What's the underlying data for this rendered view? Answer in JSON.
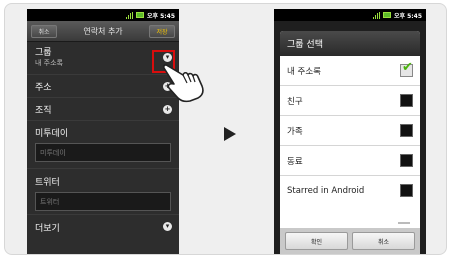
{
  "left": {
    "status": {
      "time": "오후 5:45"
    },
    "toolbar": {
      "cancel": "취소",
      "title": "연락처 추가",
      "save": "저장"
    },
    "group": {
      "label": "그룹",
      "value": "내 주소록"
    },
    "address": {
      "label": "주소"
    },
    "organization": {
      "label": "조직"
    },
    "birthday": {
      "label": "미투데이",
      "placeholder": "미투데이"
    },
    "twitter": {
      "label": "트위터",
      "placeholder": "트위터"
    },
    "more": {
      "label": "더보기"
    }
  },
  "right": {
    "status": {
      "time": "오후 5:45"
    },
    "dialog": {
      "title": "그룹 선택",
      "options": [
        {
          "label": "내 주소록",
          "checked": true
        },
        {
          "label": "친구",
          "checked": false
        },
        {
          "label": "가족",
          "checked": false
        },
        {
          "label": "동료",
          "checked": false
        },
        {
          "label": "Starred in Android",
          "checked": false
        }
      ],
      "ok": "확인",
      "cancel": "취소"
    }
  },
  "colors": {
    "highlight": "#d80d0d",
    "check": "#4ab20d"
  }
}
